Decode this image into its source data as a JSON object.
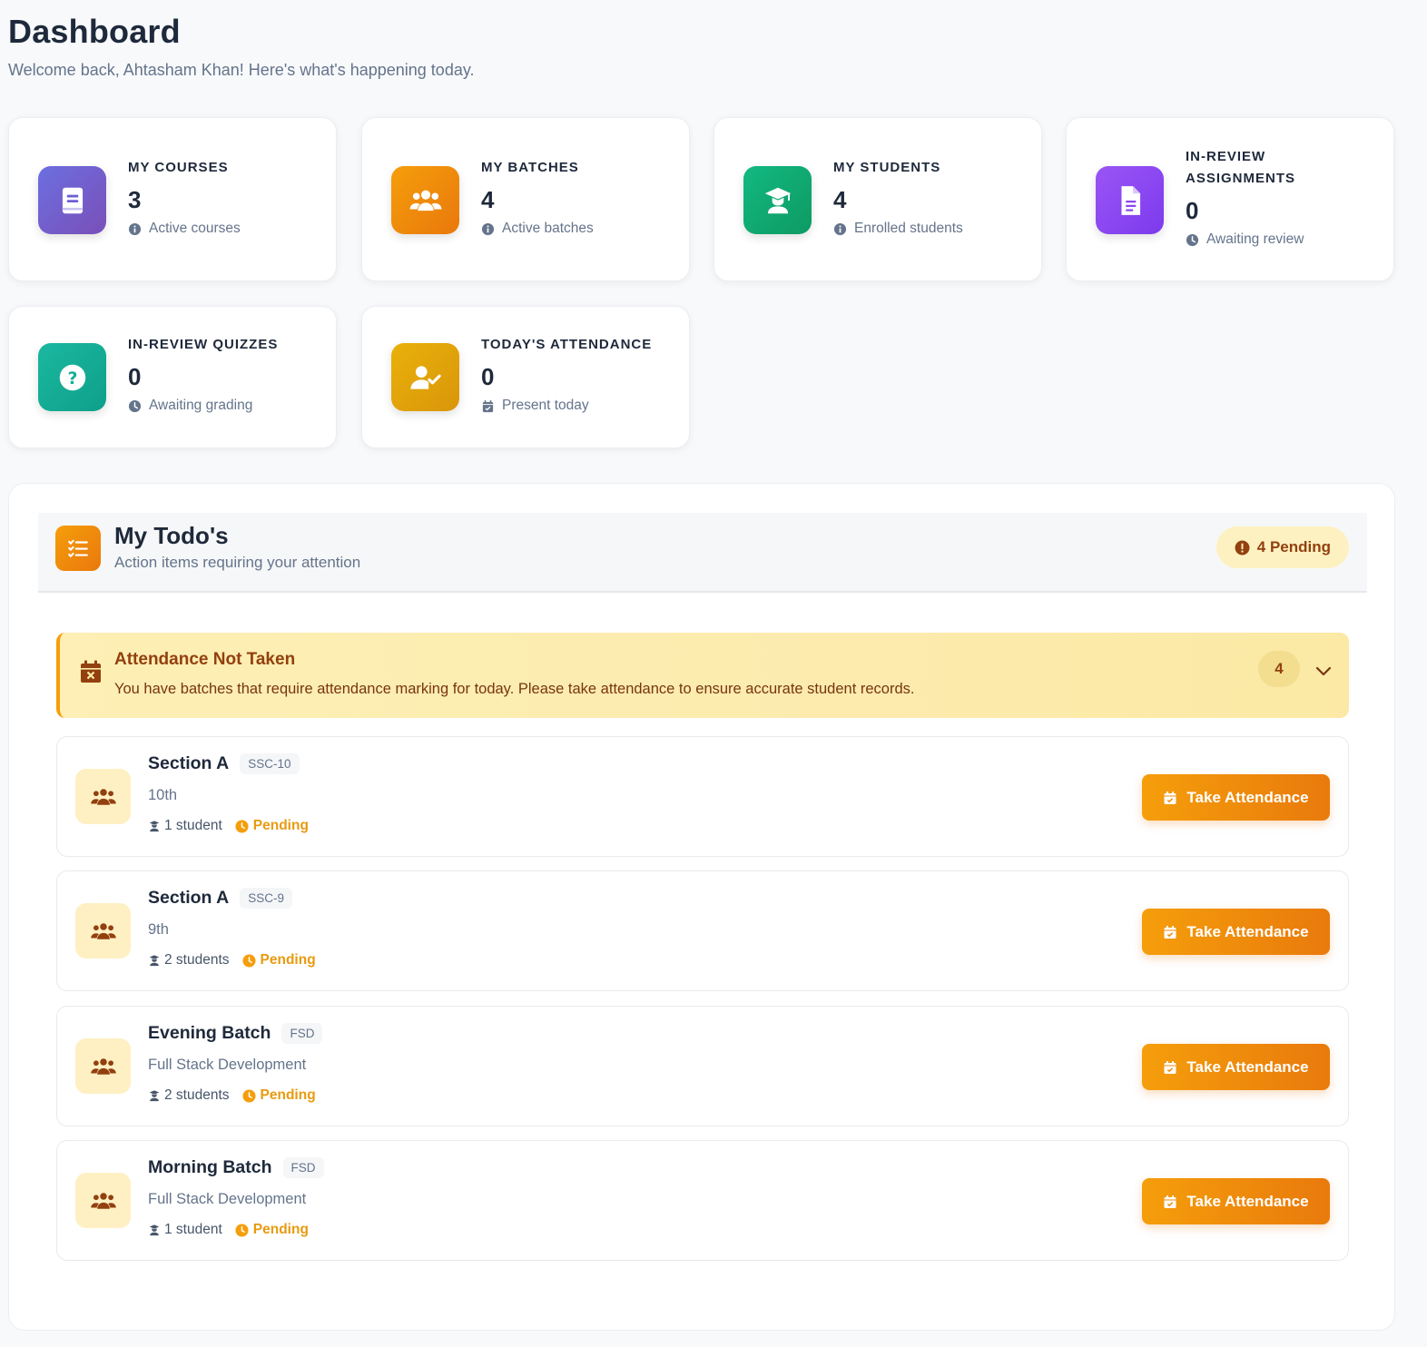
{
  "header": {
    "title": "Dashboard",
    "subtitle": "Welcome back, Ahtasham Khan! Here's what's happening today."
  },
  "stats": [
    {
      "label": "MY COURSES",
      "value": "3",
      "sub": "Active courses",
      "icon": "book-icon",
      "sub_icon": "info-icon",
      "color": "#6d5fd3"
    },
    {
      "label": "MY BATCHES",
      "value": "4",
      "sub": "Active batches",
      "icon": "users-icon",
      "sub_icon": "info-icon",
      "color": "#f08c10"
    },
    {
      "label": "MY STUDENTS",
      "value": "4",
      "sub": "Enrolled students",
      "icon": "graduate-icon",
      "sub_icon": "info-icon",
      "color": "#10a46f"
    },
    {
      "label": "IN-REVIEW ASSIGNMENTS",
      "value": "0",
      "sub": "Awaiting review",
      "icon": "document-icon",
      "sub_icon": "clock-icon",
      "color": "#8b45f0"
    },
    {
      "label": "IN-REVIEW QUIZZES",
      "value": "0",
      "sub": "Awaiting grading",
      "icon": "question-icon",
      "sub_icon": "clock-icon",
      "color": "#14b09a"
    },
    {
      "label": "TODAY'S ATTENDANCE",
      "value": "0",
      "sub": "Present today",
      "icon": "user-check-icon",
      "sub_icon": "calendar-check-icon",
      "color": "#e3a509"
    }
  ],
  "todos": {
    "title": "My Todo's",
    "subtitle": "Action items requiring your attention",
    "pending_label": "4 Pending",
    "alert": {
      "title": "Attendance Not Taken",
      "description": "You have batches that require attendance marking for today. Please take attendance to ensure accurate student records.",
      "count": "4"
    },
    "batches": [
      {
        "name": "Section A",
        "code": "SSC-10",
        "course": "10th",
        "students": "1 student",
        "status": "Pending",
        "action": "Take Attendance"
      },
      {
        "name": "Section A",
        "code": "SSC-9",
        "course": "9th",
        "students": "2 students",
        "status": "Pending",
        "action": "Take Attendance"
      },
      {
        "name": "Evening Batch",
        "code": "FSD",
        "course": "Full Stack Development",
        "students": "2 students",
        "status": "Pending",
        "action": "Take Attendance"
      },
      {
        "name": "Morning Batch",
        "code": "FSD",
        "course": "Full Stack Development",
        "students": "1 student",
        "status": "Pending",
        "action": "Take Attendance"
      }
    ]
  },
  "colors": {
    "accent": "#f59e0b",
    "accent_dark": "#e97a0c",
    "alert_text": "#92400e",
    "pending_text": "#e89a10"
  }
}
